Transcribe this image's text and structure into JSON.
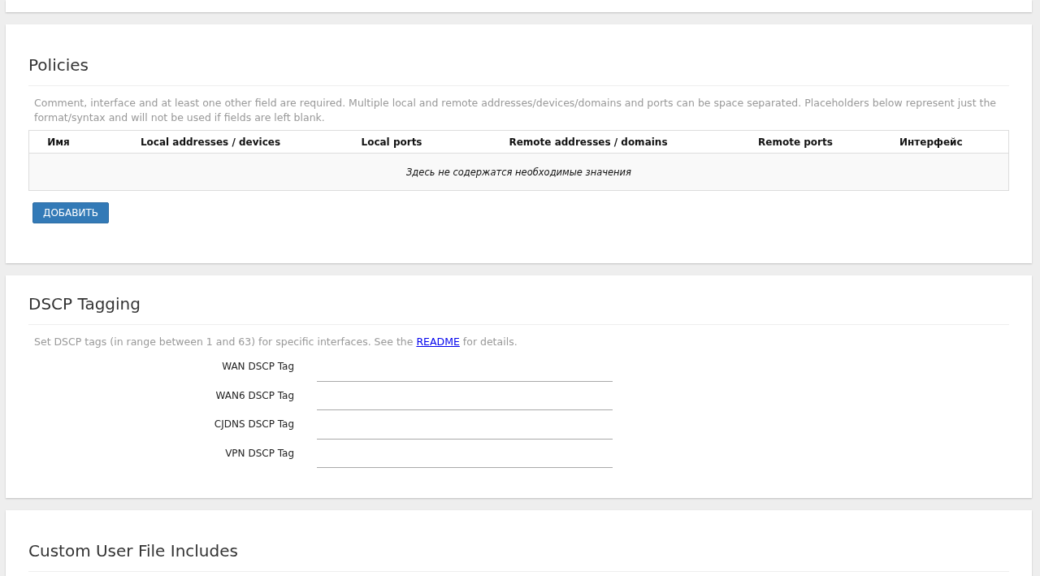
{
  "policies": {
    "title": "Policies",
    "description": "Comment, interface and at least one other field are required. Multiple local and remote addresses/devices/domains and ports can be space separated. Placeholders below represent just the format/syntax and will not be used if fields are left blank.",
    "table": {
      "columns": [
        "Имя",
        "Local addresses / devices",
        "Local ports",
        "Remote addresses / domains",
        "Remote ports",
        "Интерфейс"
      ],
      "empty_message": "Здесь не содержатся необходимые значения"
    },
    "add_button": "ДОБАВИТЬ"
  },
  "dscp": {
    "title": "DSCP Tagging",
    "description": {
      "before": "Set DSCP tags (in range between 1 and 63) for specific interfaces. See the ",
      "link": "README",
      "after": " for details."
    },
    "fields": [
      {
        "label": "WAN DSCP Tag"
      },
      {
        "label": "WAN6 DSCP Tag"
      },
      {
        "label": "CJDNS DSCP Tag"
      },
      {
        "label": "VPN DSCP Tag"
      }
    ]
  },
  "custom": {
    "title": "Custom User File Includes"
  }
}
